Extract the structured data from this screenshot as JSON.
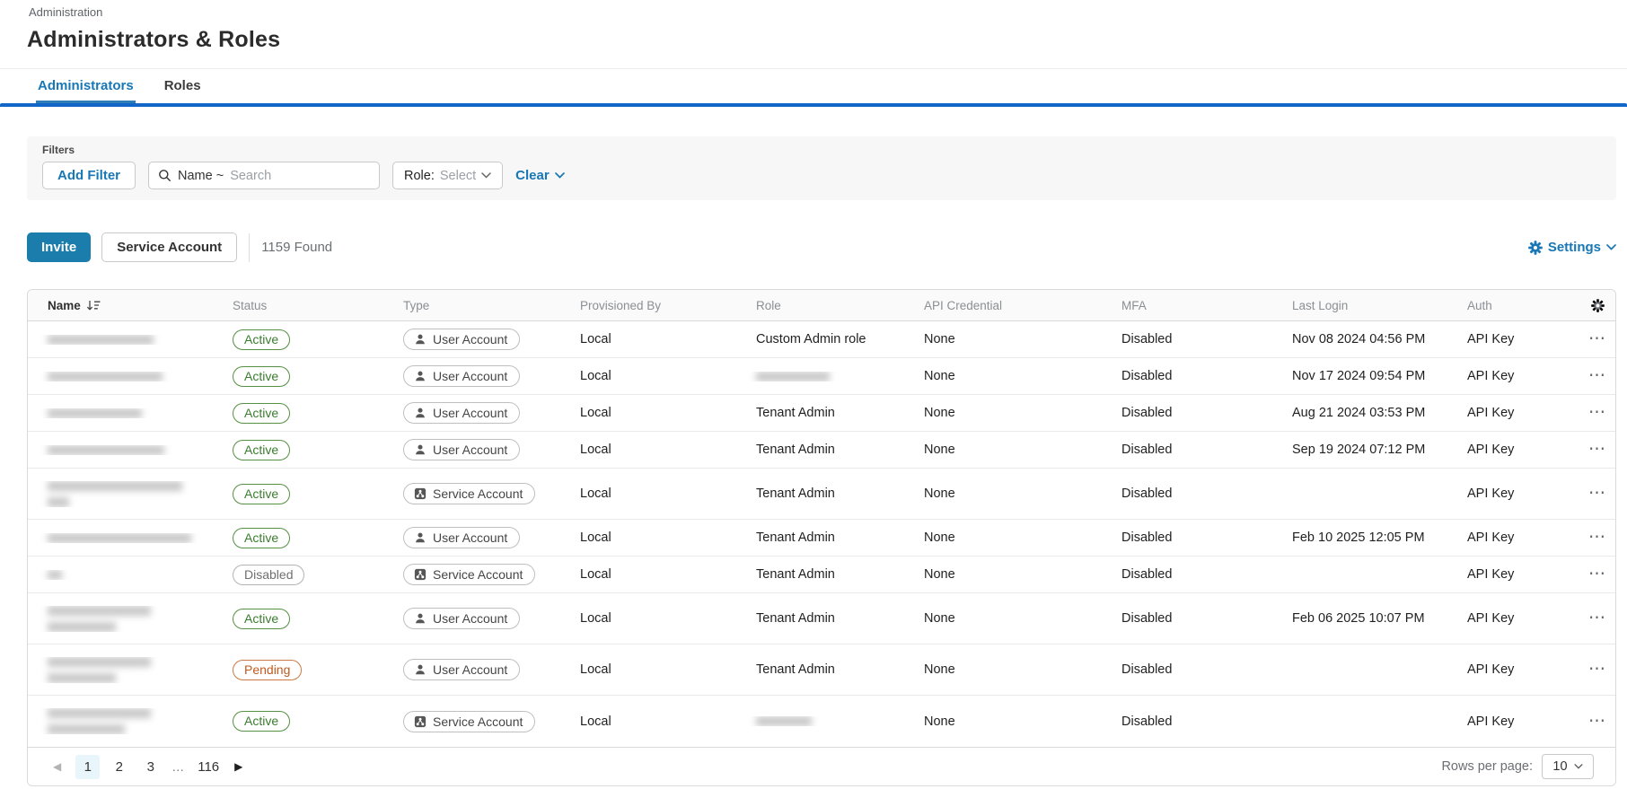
{
  "colors": {
    "accent_blue": "#1877b4",
    "invite_button_blue": "#1a7dab",
    "top_bar_blue": "#1166c8",
    "active_green": "#3a7d2e",
    "pending_orange": "#c05a1f",
    "disabled_gray": "#6f6f6f"
  },
  "page": {
    "breadcrumb": "Administration",
    "title": "Administrators & Roles"
  },
  "tabs": [
    {
      "label": "Administrators",
      "active": true
    },
    {
      "label": "Roles",
      "active": false
    }
  ],
  "filters": {
    "label": "Filters",
    "add_filter_label": "Add Filter",
    "search": {
      "icon": "search-icon",
      "prefix": "Name ~",
      "placeholder": "Search"
    },
    "role_filter": {
      "label": "Role:",
      "value": "Select",
      "icon": "chevron-down-icon"
    },
    "clear_label": "Clear"
  },
  "toolbar": {
    "invite_label": "Invite",
    "service_account_label": "Service Account",
    "found_count": "1159 Found",
    "settings_label": "Settings",
    "settings_icon": "gear-icon"
  },
  "table": {
    "columns": [
      "Name",
      "Status",
      "Type",
      "Provisioned By",
      "Role",
      "API Credential",
      "MFA",
      "Last Login",
      "Auth"
    ],
    "sort_column": "Name",
    "sort_icon": "sort-descending-icon",
    "column_settings_icon": "gear-icon",
    "type_icons": {
      "User Account": "user-icon",
      "Service Account": "service-account-icon"
    },
    "rows": [
      {
        "name_redacted": [
          118
        ],
        "status": "Active",
        "type": "User Account",
        "provisioned_by": "Local",
        "role": "Custom Admin role",
        "api_credential": "None",
        "mfa": "Disabled",
        "last_login": "Nov 08 2024 04:56 PM",
        "auth": "API Key"
      },
      {
        "name_redacted": [
          128
        ],
        "status": "Active",
        "type": "User Account",
        "provisioned_by": "Local",
        "role": null,
        "role_redacted": 82,
        "api_credential": "None",
        "mfa": "Disabled",
        "last_login": "Nov 17 2024 09:54 PM",
        "auth": "API Key"
      },
      {
        "name_redacted": [
          105
        ],
        "status": "Active",
        "type": "User Account",
        "provisioned_by": "Local",
        "role": "Tenant Admin",
        "api_credential": "None",
        "mfa": "Disabled",
        "last_login": "Aug 21 2024 03:53 PM",
        "auth": "API Key"
      },
      {
        "name_redacted": [
          130
        ],
        "status": "Active",
        "type": "User Account",
        "provisioned_by": "Local",
        "role": "Tenant Admin",
        "api_credential": "None",
        "mfa": "Disabled",
        "last_login": "Sep 19 2024 07:12 PM",
        "auth": "API Key"
      },
      {
        "name_redacted": [
          150,
          24
        ],
        "status": "Active",
        "type": "Service Account",
        "provisioned_by": "Local",
        "role": "Tenant Admin",
        "api_credential": "None",
        "mfa": "Disabled",
        "last_login": "",
        "auth": "API Key"
      },
      {
        "name_redacted": [
          160
        ],
        "status": "Active",
        "type": "User Account",
        "provisioned_by": "Local",
        "role": "Tenant Admin",
        "api_credential": "None",
        "mfa": "Disabled",
        "last_login": "Feb 10 2025 12:05 PM",
        "auth": "API Key"
      },
      {
        "name_redacted": [
          16
        ],
        "status": "Disabled",
        "type": "Service Account",
        "provisioned_by": "Local",
        "role": "Tenant Admin",
        "api_credential": "None",
        "mfa": "Disabled",
        "last_login": "",
        "auth": "API Key"
      },
      {
        "name_redacted": [
          115,
          76
        ],
        "status": "Active",
        "type": "User Account",
        "provisioned_by": "Local",
        "role": "Tenant Admin",
        "api_credential": "None",
        "mfa": "Disabled",
        "last_login": "Feb 06 2025 10:07 PM",
        "auth": "API Key"
      },
      {
        "name_redacted": [
          115,
          76
        ],
        "status": "Pending",
        "type": "User Account",
        "provisioned_by": "Local",
        "role": "Tenant Admin",
        "api_credential": "None",
        "mfa": "Disabled",
        "last_login": "",
        "auth": "API Key"
      },
      {
        "name_redacted": [
          115,
          86
        ],
        "status": "Active",
        "type": "Service Account",
        "provisioned_by": "Local",
        "role": null,
        "role_redacted": 62,
        "api_credential": "None",
        "mfa": "Disabled",
        "last_login": "",
        "auth": "API Key"
      }
    ],
    "row_actions_icon": "ellipsis-icon"
  },
  "pagination": {
    "prev_icon": "chevron-left-icon",
    "next_icon": "chevron-right-icon",
    "pages": [
      "1",
      "2",
      "3",
      "…",
      "116"
    ],
    "current_page": "1",
    "rows_per_page_label": "Rows per page:",
    "rows_per_page_value": "10"
  }
}
